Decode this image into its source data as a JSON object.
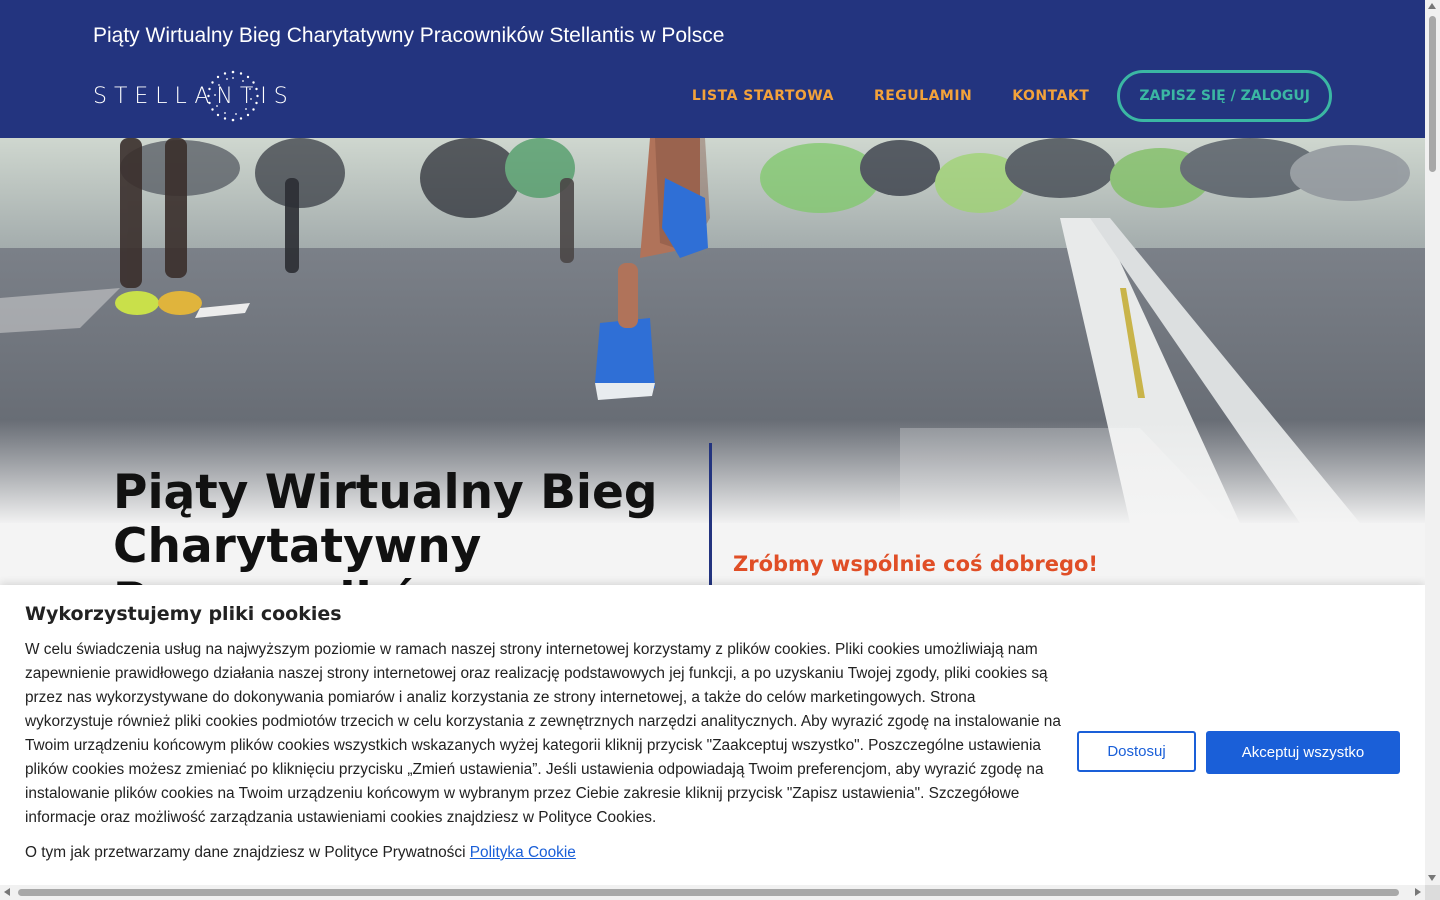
{
  "header": {
    "site_title": "Piąty Wirtualny Bieg Charytatywny Pracowników Stellantis w Polsce",
    "logo_text": "STELLANTIS",
    "nav": [
      {
        "label": "LISTA STARTOWA"
      },
      {
        "label": "REGULAMIN"
      },
      {
        "label": "KONTAKT"
      }
    ],
    "cta_label": "ZAPISZ SIĘ / ZALOGUJ"
  },
  "hero": {
    "heading": "Piąty Wirtualny Bieg Charytatywny Pracowników Stellantis",
    "tagline": "Zróbmy wspólnie coś dobrego!"
  },
  "cookie": {
    "title": "Wykorzystujemy pliki cookies",
    "body": "W celu świadczenia usług na najwyższym poziomie w ramach naszej strony internetowej korzystamy z plików cookies. Pliki cookies umożliwiają nam zapewnienie prawidłowego działania naszej strony internetowej oraz realizację podstawowych jej funkcji, a po uzyskaniu Twojej zgody, pliki cookies są przez nas wykorzystywane do dokonywania pomiarów i analiz korzystania ze strony internetowej, a także do celów marketingowych. Strona wykorzystuje również pliki cookies podmiotów trzecich w celu korzystania z zewnętrznych narzędzi analitycznych. Aby wyrazić zgodę na instalowanie na Twoim urządzeniu końcowym plików cookies wszystkich wskazanych wyżej kategorii kliknij przycisk \"Zaakceptuj wszystko\". Poszczególne ustawienia plików cookies możesz zmieniać po kliknięciu przycisku „Zmień ustawienia”. Jeśli ustawienia odpowiadają Twoim preferencjom, aby wyrazić zgodę na instalowanie plików cookies na Twoim urządzeniu końcowym w wybranym przez Ciebie zakresie kliknij przycisk \"Zapisz ustawienia\". Szczegółowe informacje oraz możliwość zarządzania ustawieniami cookies znajdziesz w Polityce Cookies.",
    "policy_text": "O tym jak przetwarzamy dane znajdziesz w Polityce Prywatności",
    "policy_link": "Polityka Cookie",
    "customize_label": "Dostosuj",
    "accept_label": "Akceptuj wszystko"
  },
  "colors": {
    "header_bg": "#23347f",
    "nav_link": "#f3a23b",
    "cta": "#3bb7a3",
    "tagline": "#e04e26",
    "button_primary": "#1a5fd8"
  }
}
